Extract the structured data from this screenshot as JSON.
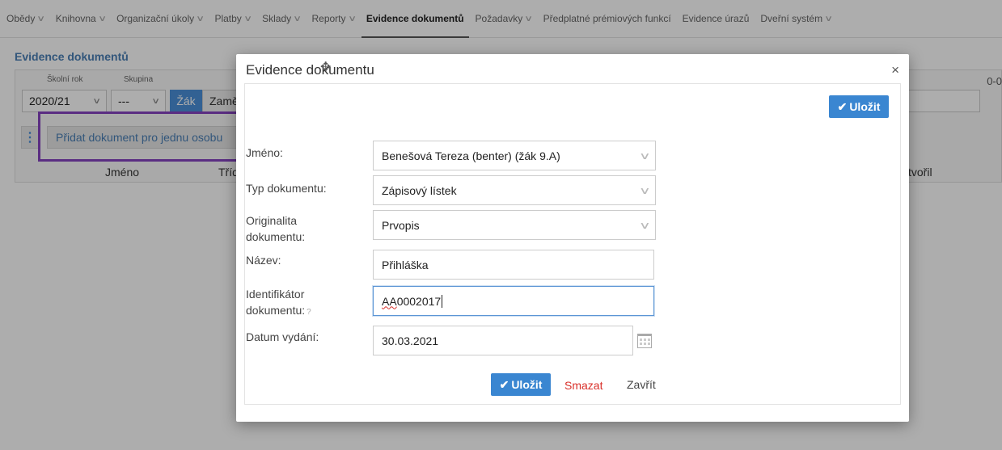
{
  "nav": {
    "items": [
      {
        "label": "Obědy",
        "dropdown": true
      },
      {
        "label": "Knihovna",
        "dropdown": true
      },
      {
        "label": "Organizační úkoly",
        "dropdown": true
      },
      {
        "label": "Platby",
        "dropdown": true
      },
      {
        "label": "Sklady",
        "dropdown": true
      },
      {
        "label": "Reporty",
        "dropdown": true
      },
      {
        "label": "Evidence dokumentů",
        "dropdown": false,
        "active": true
      },
      {
        "label": "Požadavky",
        "dropdown": true
      },
      {
        "label": "Předplatné prémiových funkcí",
        "dropdown": false
      },
      {
        "label": "Evidence úrazů",
        "dropdown": false
      },
      {
        "label": "Dveřní systém",
        "dropdown": true
      }
    ]
  },
  "page": {
    "title": "Evidence dokumentů",
    "filters": {
      "school_year_label": "Školní rok",
      "school_year_value": "2020/21",
      "group_label": "Skupina",
      "group_value": "---",
      "toggle_student": "Žák",
      "toggle_employee": "Zamě"
    },
    "pager_text": "0-0",
    "add_document_label": "Přidat dokument pro jednu osobu",
    "columns": {
      "name": "Jméno",
      "class": "Tříd",
      "created_by": "tvořil"
    }
  },
  "modal": {
    "title": "Evidence dokumentu",
    "save_label": "Uložit",
    "delete_label": "Smazat",
    "close_label": "Zavřít",
    "fields": {
      "name_label": "Jméno:",
      "name_value": "Benešová Tereza (benter)  (žák 9.A)",
      "doc_type_label": "Typ dokumentu:",
      "doc_type_value": "Zápisový lístek",
      "originality_label_1": "Originalita",
      "originality_label_2": "dokumentu:",
      "originality_value": "Prvopis",
      "title_label": "Název:",
      "title_value": "Přihláška",
      "identifier_label_1": "Identifikátor",
      "identifier_label_2": "dokumentu:",
      "identifier_hint": "?",
      "identifier_prefix": "AA",
      "identifier_rest": " 0002017",
      "date_label": "Datum vydání:",
      "date_value": "30.03.2021"
    }
  }
}
